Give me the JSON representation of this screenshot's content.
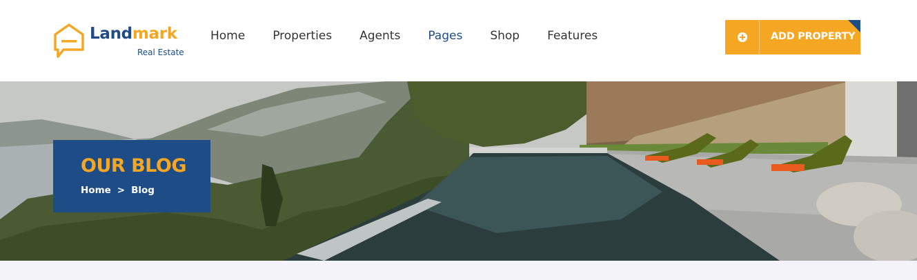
{
  "brand": {
    "name_part1": "Land",
    "name_part2": "mark",
    "tagline": "Real Estate",
    "color_primary": "#1d4c86",
    "color_accent": "#f5a623"
  },
  "nav": {
    "items": [
      {
        "label": "Home",
        "active": false
      },
      {
        "label": "Properties",
        "active": false
      },
      {
        "label": "Agents",
        "active": false
      },
      {
        "label": "Pages",
        "active": true
      },
      {
        "label": "Shop",
        "active": false
      },
      {
        "label": "Features",
        "active": false
      }
    ]
  },
  "cta": {
    "icon": "plus-circle-icon",
    "label": "ADD PROPERTY"
  },
  "hero": {
    "title": "OUR BLOG",
    "breadcrumb": {
      "home": "Home",
      "separator": ">",
      "current": "Blog"
    }
  }
}
